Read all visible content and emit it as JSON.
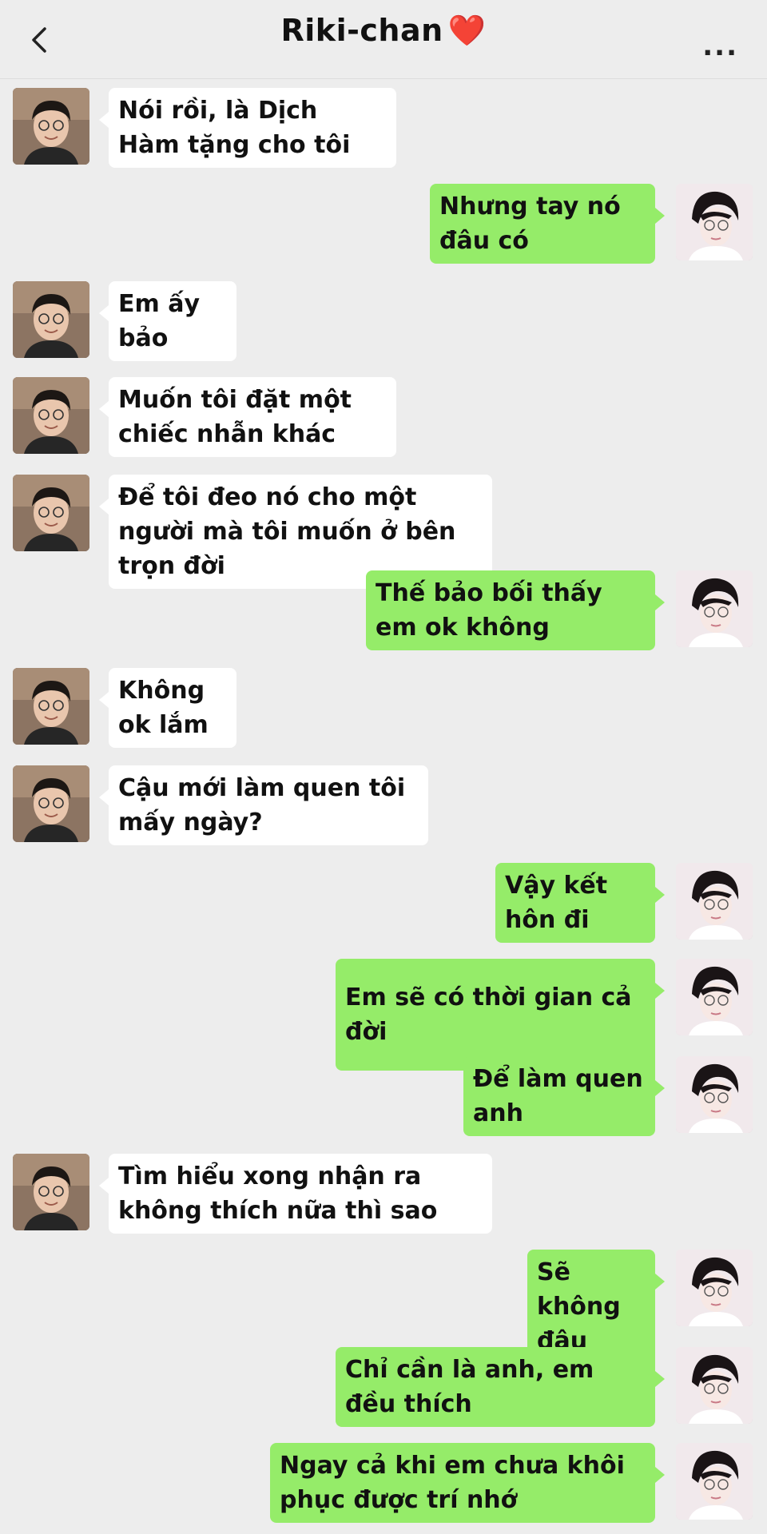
{
  "header": {
    "title": "Riki-chan",
    "heart": "❤️",
    "more": "..."
  },
  "messages": [
    {
      "side": "in",
      "text": "Nói rồi, là Dịch Hàm tặng cho tôi"
    },
    {
      "side": "out",
      "text": "Nhưng tay nó đâu có"
    },
    {
      "side": "in",
      "text": "Em ấy bảo"
    },
    {
      "side": "in",
      "text": "Muốn tôi đặt một chiếc nhẫn khác"
    },
    {
      "side": "in",
      "text": "Để tôi đeo nó cho một người mà tôi muốn ở bên trọn đời"
    },
    {
      "side": "out",
      "text": "Thế bảo bối thấy em ok không"
    },
    {
      "side": "in",
      "text": "Không ok lắm"
    },
    {
      "side": "in",
      "text": "Cậu mới làm quen tôi mấy ngày?"
    },
    {
      "side": "out",
      "text": "Vậy kết hôn đi"
    },
    {
      "side": "out",
      "text": "Em sẽ có thời gian cả đời"
    },
    {
      "side": "out",
      "text": "Để làm quen anh"
    },
    {
      "side": "in",
      "text": "Tìm hiểu xong nhận ra không thích nữa thì sao"
    },
    {
      "side": "out",
      "text": "Sẽ không đâu"
    },
    {
      "side": "out",
      "text": "Chỉ cần là anh, em đều thích"
    },
    {
      "side": "out",
      "text": "Ngay cả khi em chưa khôi phục được trí nhớ"
    }
  ],
  "colors": {
    "background": "#ededed",
    "incoming_bubble": "#ffffff",
    "outgoing_bubble": "#95ec69",
    "heart": "#e0232f"
  },
  "icons": {
    "back": "chevron-left-icon",
    "more": "more-dots-icon"
  }
}
